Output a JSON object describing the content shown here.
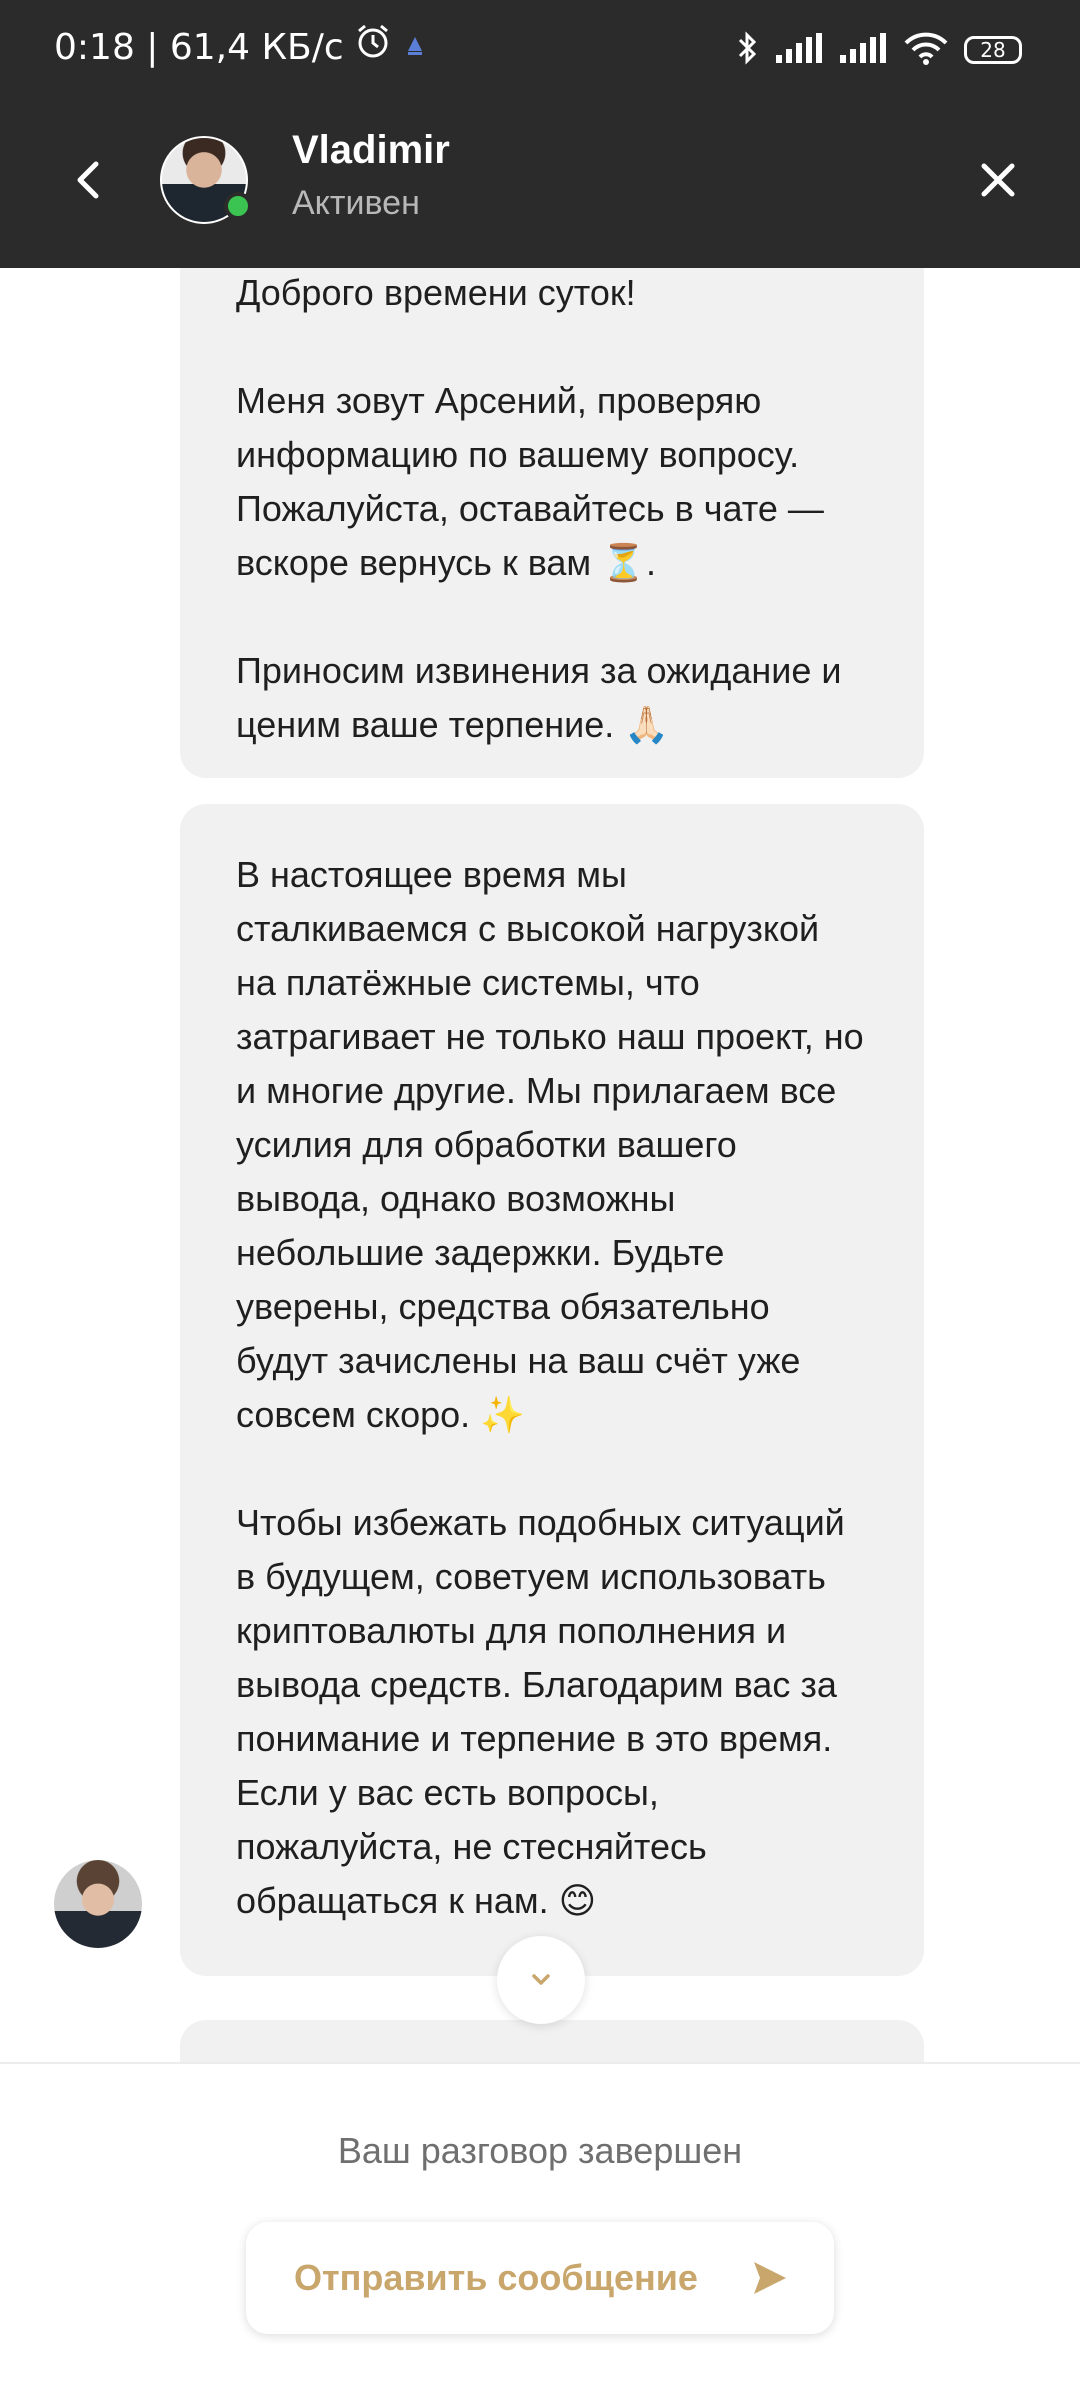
{
  "status_bar": {
    "time_and_speed": "0:18 | 61,4 КБ/с",
    "battery": "28",
    "icons": [
      "alarm-icon",
      "notification-icon",
      "bluetooth-icon",
      "signal-icon",
      "signal-icon",
      "wifi-icon",
      "battery-icon"
    ]
  },
  "header": {
    "name": "Vladimir",
    "status": "Активен",
    "accent_online": "#3bc451"
  },
  "messages": [
    {
      "text": "Доброго времени суток!\n\nМеня зовут Арсений, проверяю информацию по вашему вопросу. Пожалуйста, оставайтесь в чате — вскоре вернусь к вам ⏳.\n\nПриносим извинения за ожидание и ценим ваше терпение. 🙏🏻"
    },
    {
      "text": "В настоящее время мы сталкиваемся с высокой нагрузкой на платёжные системы, что затрагивает не только наш проект, но и многие другие. Мы прилагаем все усилия для обработки вашего вывода, однако возможны небольшие задержки. Будьте уверены, средства обязательно будут зачислены на ваш счёт уже совсем скоро. ✨\n\nЧтобы избежать подобных ситуаций в будущем, советуем использовать криптовалюты для пополнения и вывода средств. Благодарим вас за понимание и терпение в это время. Если у вас есть вопросы, пожалуйста, не стесняйтесь обращаться к нам. 😊"
    }
  ],
  "footer": {
    "ended_text": "Ваш разговор завершен",
    "send_label": "Отправить сообщение",
    "accent": "#c9a66b"
  },
  "colors": {
    "header_bg": "#2b2b2b",
    "bubble_bg": "#f1f1f1"
  }
}
